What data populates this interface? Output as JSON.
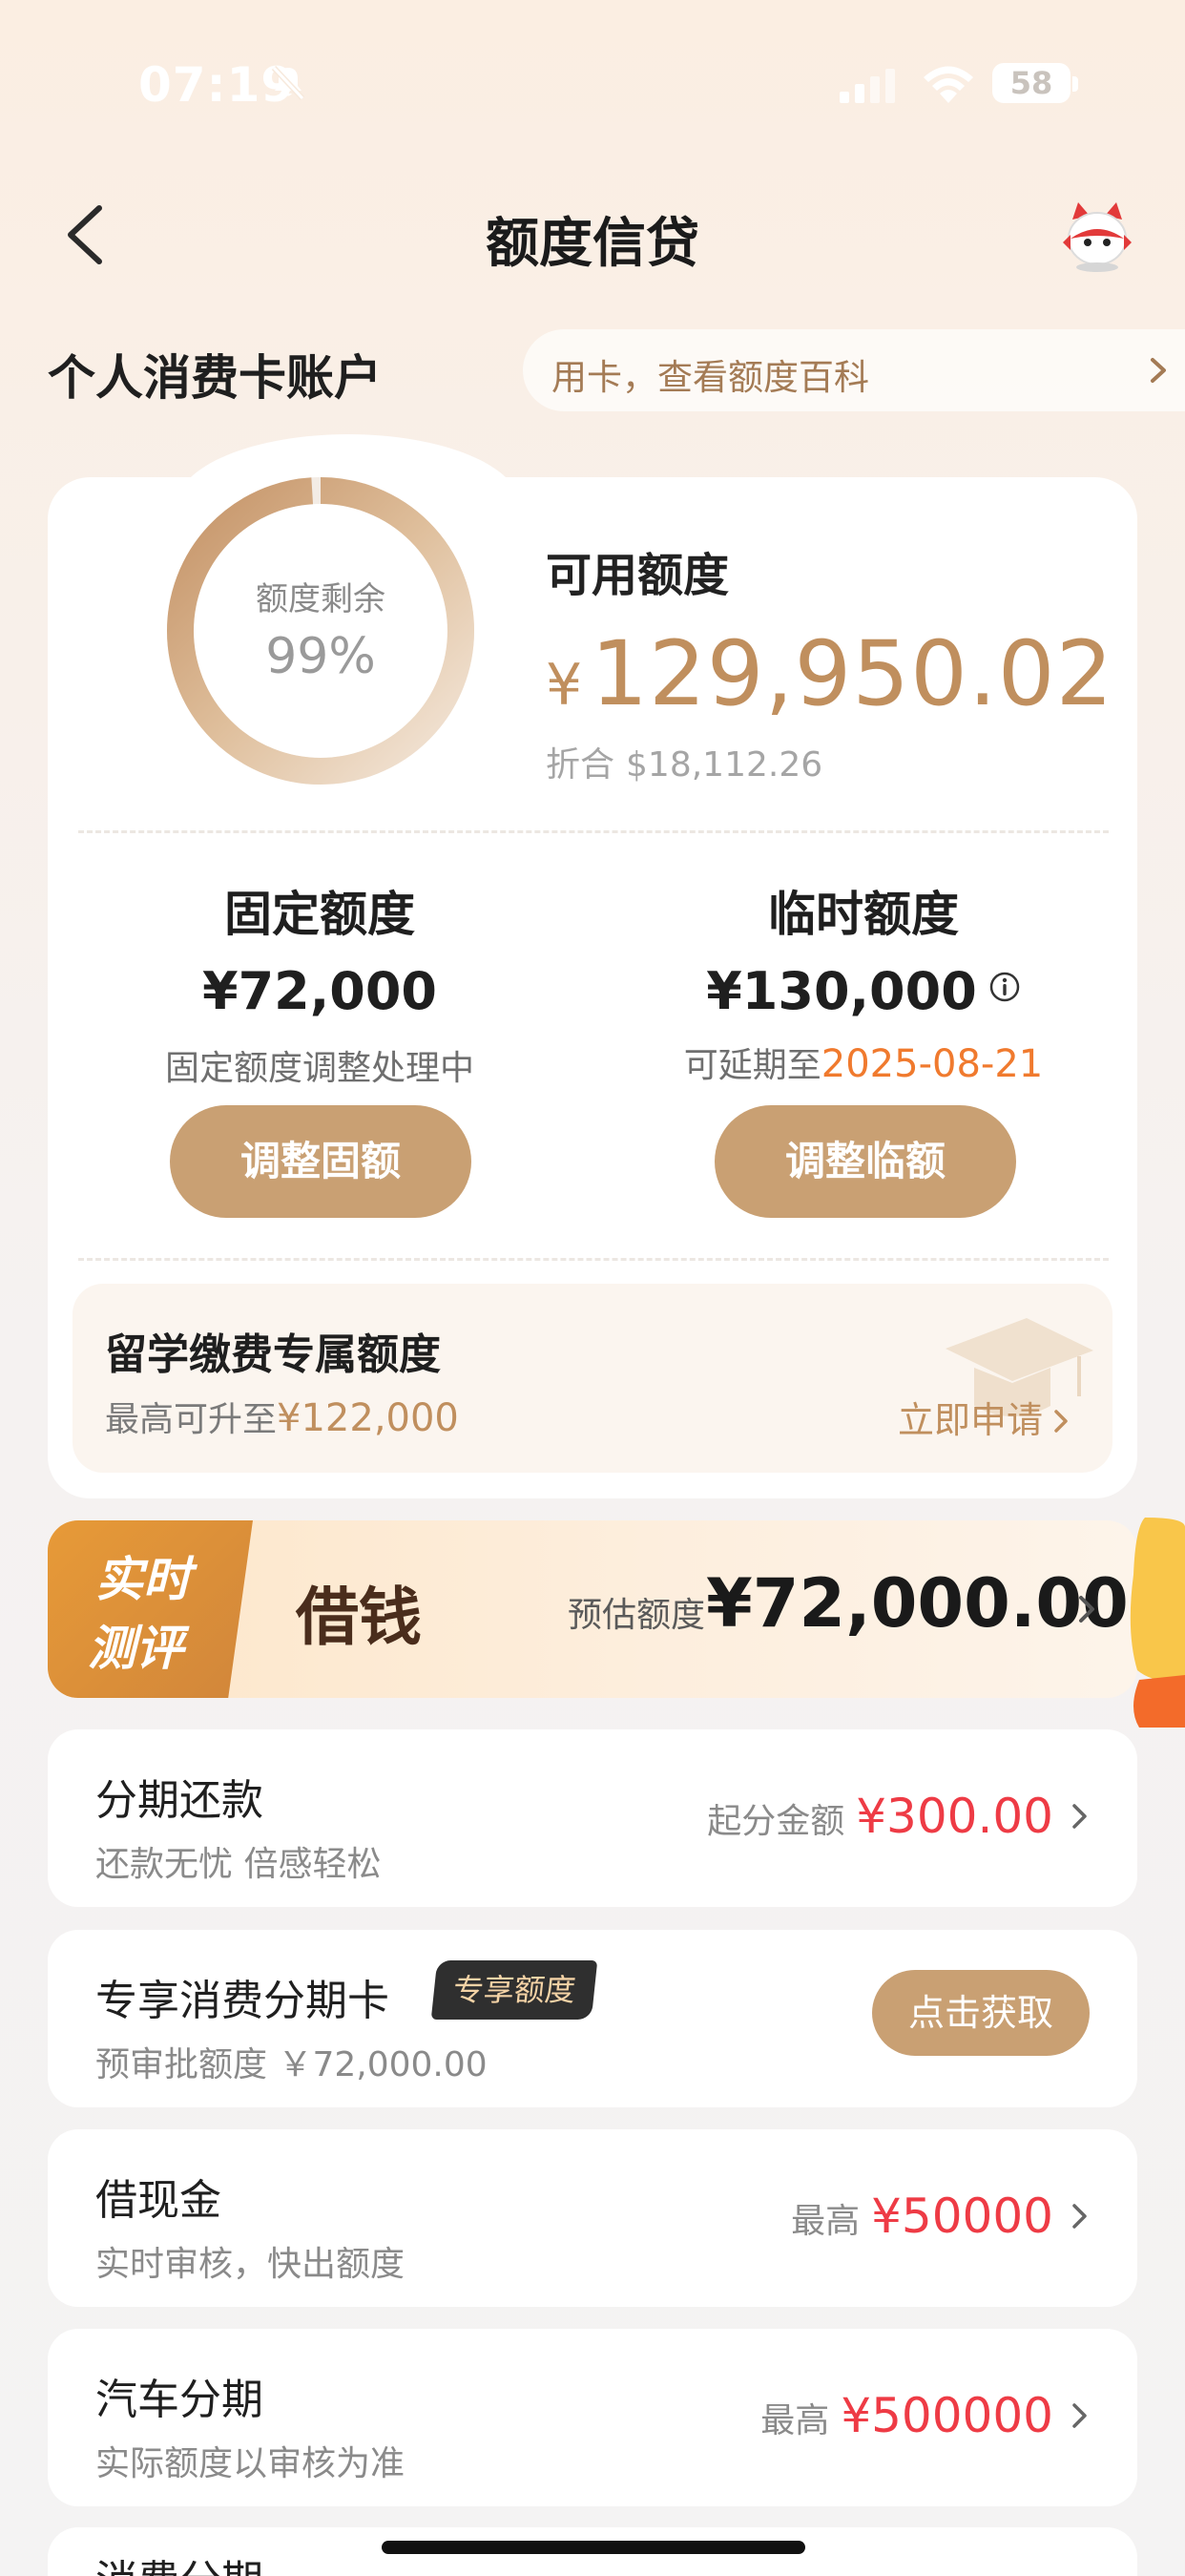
{
  "status_bar": {
    "time": "07:19",
    "battery": "58",
    "icons": [
      "bell-slash-icon",
      "signal-icon",
      "wifi-icon",
      "battery-icon"
    ]
  },
  "nav": {
    "title": "额度信贷",
    "back_icon": "chevron-left-icon",
    "mascot_icon": "mascot-icon"
  },
  "account": {
    "section_title": "个人消费卡账户",
    "marquee": "用卡，查看额度百科"
  },
  "credit": {
    "ring_label": "额度剩余",
    "ring_value": "99%",
    "ring_fraction": 0.99,
    "available_label": "可用额度",
    "available_currency": "¥",
    "available_amount": "129,950.02",
    "equiv_label": "折合",
    "equiv_amount": "$18,112.26",
    "fixed": {
      "title": "固定额度",
      "amount": "¥72,000",
      "note": "固定额度调整处理中",
      "button": "调整固额"
    },
    "temp": {
      "title": "临时额度",
      "amount": "¥130,000",
      "note_prefix": "可延期至",
      "note_date": "2025-08-21",
      "button": "调整临额"
    },
    "study": {
      "title": "留学缴费专属额度",
      "sub_prefix": "最高可升至",
      "sub_amount": "¥122,000",
      "action": "立即申请"
    }
  },
  "borrow": {
    "tag_line1": "实时",
    "tag_line2": "测评",
    "title": "借钱",
    "estimate_label": "预估额度",
    "estimate_amount": "¥72,000.00"
  },
  "items": [
    {
      "title": "分期还款",
      "sub": "还款无忧 倍感轻松",
      "right_label": "起分金额",
      "right_value": "¥300.00"
    },
    {
      "title": "专享消费分期卡",
      "badge": "专享额度",
      "sub": "预审批额度 ￥72,000.00",
      "button": "点击获取"
    },
    {
      "title": "借现金",
      "sub": "实时审核，快出额度",
      "right_label": "最高",
      "right_value": "¥50000"
    },
    {
      "title": "汽车分期",
      "sub": "实际额度以审核为准",
      "right_label": "最高",
      "right_value": "¥500000"
    },
    {
      "title": "消费分期"
    }
  ],
  "colors": {
    "accent_gold": "#c9a073",
    "amount_gold": "#c08f5e",
    "date_orange": "#f07a2e",
    "price_red": "#ee3b45"
  }
}
